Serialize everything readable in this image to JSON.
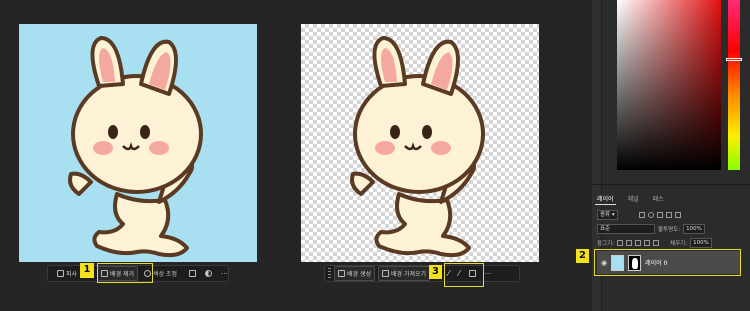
{
  "colors": {
    "accent_highlight": "#f2e21b",
    "canvas_bg": "#a8e0f2",
    "ui_bg": "#252525"
  },
  "left_toolbar": {
    "select_subject_label": "피사",
    "remove_bg_label": "배경 제거",
    "color_adjust_label": "색상 조정",
    "more_label": "···"
  },
  "right_toolbar": {
    "generate_bg_label": "배경 생성",
    "import_bg_label": "배경 가져오기",
    "more_label": "···"
  },
  "badges": {
    "one": "1",
    "two": "2",
    "three": "3"
  },
  "layers_panel": {
    "tabs": [
      "레이어",
      "채널",
      "패스"
    ],
    "kind_label": "종류",
    "blend_mode": "표준",
    "opacity_label": "불투명도:",
    "opacity_value": "100%",
    "lock_label": "잠그기:",
    "fill_label": "채우기:",
    "fill_value": "100%",
    "layer_name": "레이어 0"
  }
}
